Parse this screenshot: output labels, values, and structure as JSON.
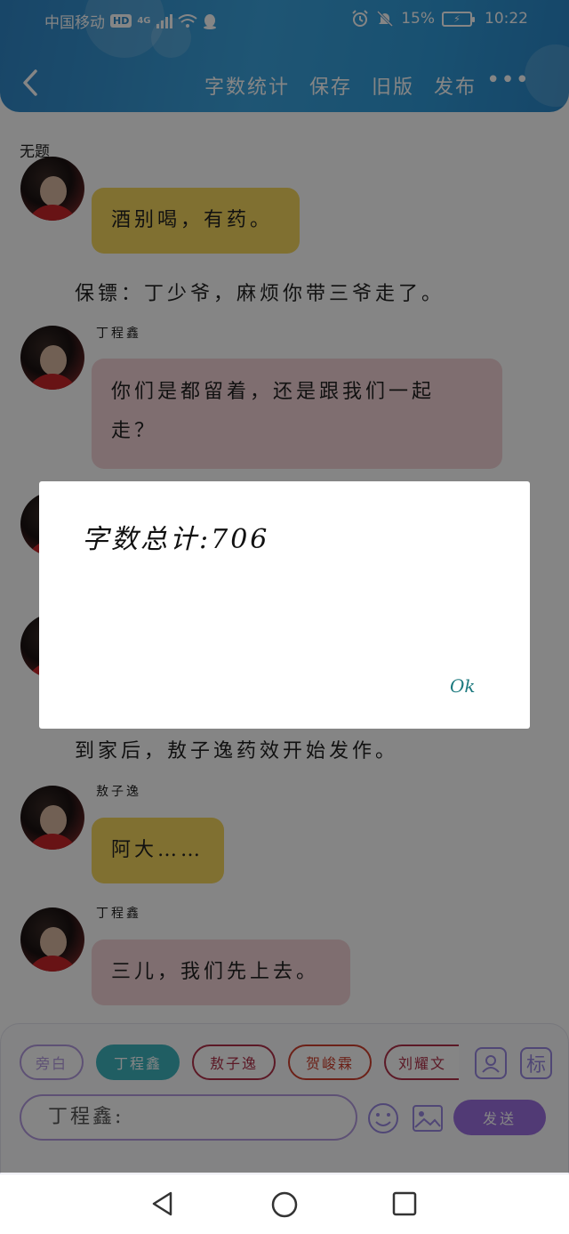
{
  "status_bar": {
    "carrier": "中国移动",
    "network_badge": "HD",
    "signal_type": "4G",
    "battery_percent": "15%",
    "time": "10:22"
  },
  "nav": {
    "actions": [
      "字数统计",
      "保存",
      "旧版",
      "发布"
    ],
    "more_label": "•••"
  },
  "doc_title": "无题",
  "messages": [
    {
      "type": "bubble",
      "color": "yellow",
      "speaker": "",
      "text": "酒别喝，有药。"
    },
    {
      "type": "narration",
      "text": "保镖：丁少爷，麻烦你带三爷走了。"
    },
    {
      "type": "bubble",
      "color": "pink",
      "speaker": "丁程鑫",
      "line1": "你们是都留着，还是跟我们一起",
      "line2": "走？"
    },
    {
      "type": "narration",
      "text": "到家后，敖子逸药效开始发作。"
    },
    {
      "type": "bubble",
      "color": "yellow",
      "speaker": "敖子逸",
      "text": "阿大……"
    },
    {
      "type": "bubble",
      "color": "pink",
      "speaker": "丁程鑫",
      "text": "三儿，我们先上去。"
    }
  ],
  "composer": {
    "chips": [
      {
        "label": "旁白",
        "border": "#b49be0",
        "text": "#b49be0",
        "bg": "#ffffff"
      },
      {
        "label": "丁程鑫",
        "border": "#3fb4bf",
        "text": "#ffffff",
        "bg": "#3fb4bf"
      },
      {
        "label": "敖子逸",
        "border": "#b0304a",
        "text": "#b0304a",
        "bg": "#ffffff"
      },
      {
        "label": "贺峻霖",
        "border": "#d0402e",
        "text": "#d0402e",
        "bg": "#ffffff"
      },
      {
        "label": "刘耀文",
        "border": "#b0304a",
        "text": "#b0304a",
        "bg": "#ffffff"
      }
    ],
    "avatar_tool_icon": "person-icon",
    "label_tool_text": "标",
    "input_value": "丁程鑫:",
    "send_label": "发送"
  },
  "dialog": {
    "message": "字数总计:706",
    "ok_label": "Ok"
  },
  "colors": {
    "header": "#3ca4de",
    "yellow_bubble": "#f6d75f",
    "pink_bubble": "#f3d4d7",
    "accent": "#9b6fe0"
  }
}
